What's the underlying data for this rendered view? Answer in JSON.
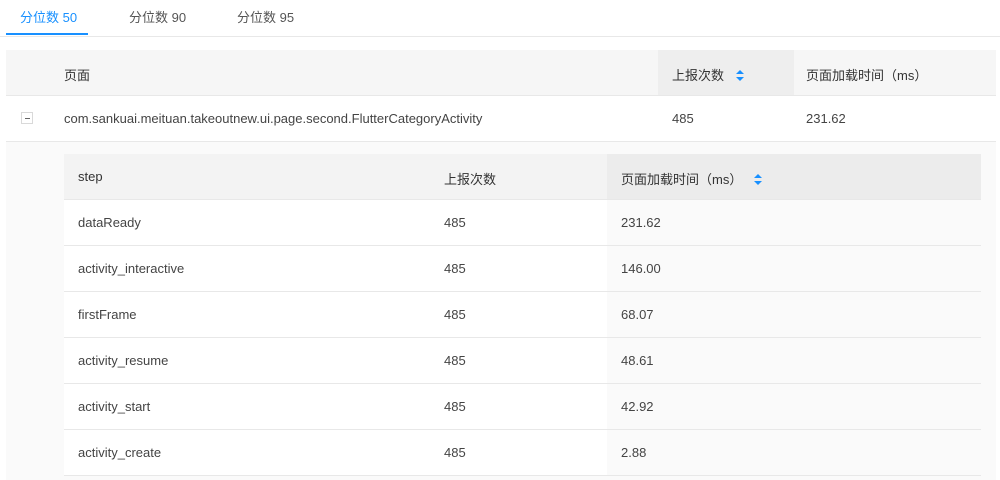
{
  "tabs": [
    {
      "label": "分位数 50",
      "active": true
    },
    {
      "label": "分位数 90",
      "active": false
    },
    {
      "label": "分位数 95",
      "active": false
    }
  ],
  "main_table": {
    "columns": {
      "page": "页面",
      "report_count": "上报次数",
      "load_time": "页面加载时间（ms）"
    },
    "rows": [
      {
        "page": "com.sankuai.meituan.takeoutnew.ui.page.second.FlutterCategoryActivity",
        "report_count": "485",
        "load_time": "231.62",
        "expanded": true
      }
    ]
  },
  "step_table": {
    "columns": {
      "step": "step",
      "report_count": "上报次数",
      "load_time": "页面加载时间（ms）"
    },
    "rows": [
      {
        "step": "dataReady",
        "report_count": "485",
        "load_time": "231.62"
      },
      {
        "step": "activity_interactive",
        "report_count": "485",
        "load_time": "146.00"
      },
      {
        "step": "firstFrame",
        "report_count": "485",
        "load_time": "68.07"
      },
      {
        "step": "activity_resume",
        "report_count": "485",
        "load_time": "48.61"
      },
      {
        "step": "activity_start",
        "report_count": "485",
        "load_time": "42.92"
      },
      {
        "step": "activity_create",
        "report_count": "485",
        "load_time": "2.88"
      }
    ]
  },
  "colors": {
    "accent": "#1890ff",
    "header_bg": "#f6f6f6",
    "expanded_bg": "#fafafa",
    "border": "#e8e8e8"
  },
  "icons": {
    "sort": "sort-icon",
    "collapse": "collapse-icon"
  }
}
